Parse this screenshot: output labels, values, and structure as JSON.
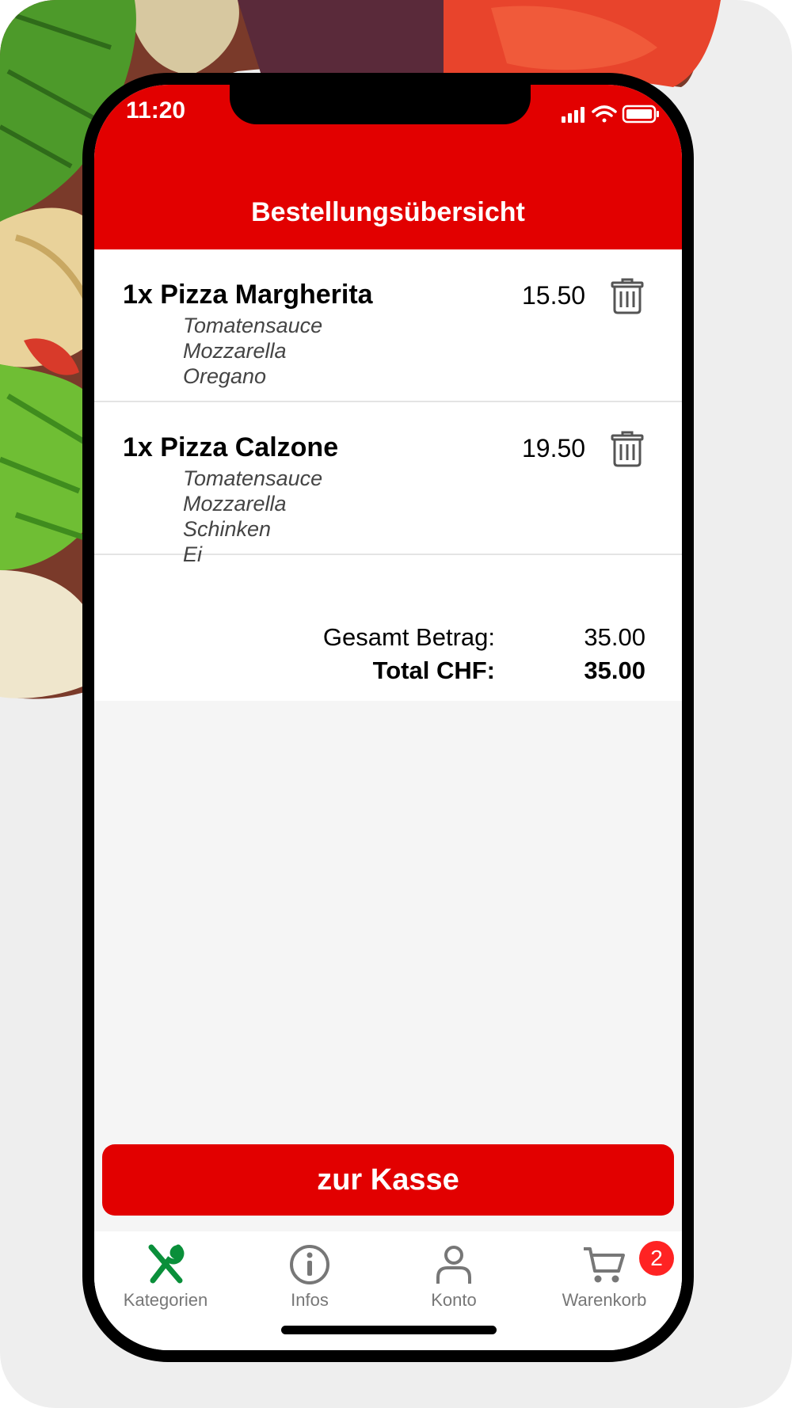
{
  "status_bar": {
    "time": "11:20"
  },
  "header": {
    "title": "Bestellungsübersicht"
  },
  "order_items": [
    {
      "name": "1x Pizza Margherita",
      "price": "15.50",
      "ingredients": [
        "Tomatensauce",
        "Mozzarella",
        "Oregano"
      ]
    },
    {
      "name": "1x Pizza Calzone",
      "price": "19.50",
      "ingredients": [
        "Tomatensauce",
        "Mozzarella",
        "Schinken",
        "Ei"
      ]
    }
  ],
  "totals": {
    "subtotal_label": "Gesamt Betrag:",
    "subtotal_value": "35.00",
    "total_label": "Total CHF:",
    "total_value": "35.00"
  },
  "checkout_button": {
    "label": "zur Kasse"
  },
  "tab_bar": {
    "tabs": [
      {
        "label": "Kategorien",
        "icon": "fork-spoon-icon",
        "active": true
      },
      {
        "label": "Infos",
        "icon": "info-icon",
        "active": false
      },
      {
        "label": "Konto",
        "icon": "person-icon",
        "active": false
      },
      {
        "label": "Warenkorb",
        "icon": "cart-icon",
        "active": false
      }
    ],
    "cart_badge": "2"
  },
  "colors": {
    "brand_red": "#e20000",
    "active_tab_green": "#0a8f3a",
    "badge_red": "#ff2323",
    "background_grey": "#f5f5f5"
  }
}
